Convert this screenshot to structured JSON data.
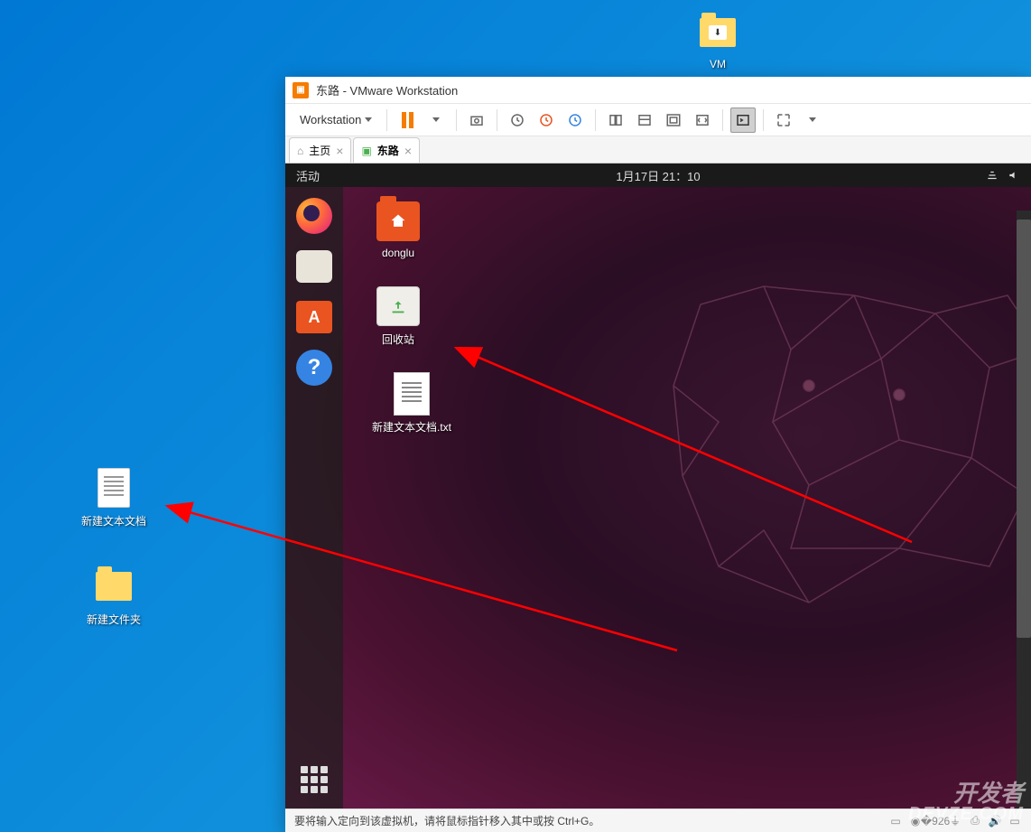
{
  "windows_desktop": {
    "icons": {
      "vm_folder": "VM",
      "text_doc": "新建文本文档",
      "new_folder": "新建文件夹"
    }
  },
  "vmware": {
    "title": "东路 - VMware Workstation",
    "menu": {
      "workstation": "Workstation"
    },
    "tabs": {
      "home": "主页",
      "vm": "东路"
    },
    "statusbar_hint": "要将输入定向到该虚拟机，请将鼠标指针移入其中或按 Ctrl+G。"
  },
  "ubuntu": {
    "activities": "活动",
    "datetime": "1月17日  21：10",
    "desktop_icons": {
      "home": "donglu",
      "trash": "回收站",
      "textfile": "新建文本文档.txt"
    }
  },
  "watermark": {
    "line1": "开发者",
    "line2": "DEVZE.COM"
  }
}
